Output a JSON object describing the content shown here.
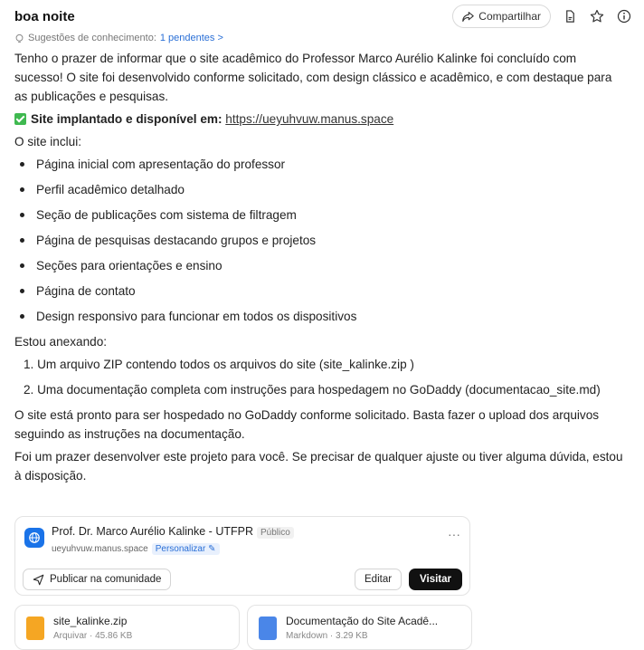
{
  "header": {
    "title": "boa noite",
    "share_label": "Compartilhar"
  },
  "suggestions": {
    "label": "Sugestões de conhecimento:",
    "pending": "1 pendentes >"
  },
  "message": {
    "intro": "Tenho o prazer de informar que o site acadêmico do Professor Marco Aurélio Kalinke foi concluído com sucesso! O site foi desenvolvido conforme solicitado, com design clássico e acadêmico, e com destaque para as publicações e pesquisas.",
    "deployed_label": "Site implantado e disponível em:",
    "deployed_url": "https://ueyuhvuw.manus.space",
    "includes_heading": "O site inclui:",
    "features": [
      "Página inicial com apresentação do professor",
      "Perfil acadêmico detalhado",
      "Seção de publicações com sistema de filtragem",
      "Página de pesquisas destacando grupos e projetos",
      "Seções para orientações e ensino",
      "Página de contato",
      "Design responsivo para funcionar em todos os dispositivos"
    ],
    "attaching_heading": "Estou anexando:",
    "attachments_list": [
      "1. Um arquivo ZIP contendo todos os arquivos do site (site_kalinke.zip )",
      "2. Uma documentação completa com instruções para hospedagem no GoDaddy (documentacao_site.md)"
    ],
    "ready_text": "O site está pronto para ser hospedado no GoDaddy conforme solicitado. Basta fazer o upload dos arquivos seguindo as instruções na documentação.",
    "closing_text": "Foi um prazer desenvolver este projeto para você. Se precisar de qualquer ajuste ou tiver alguma dúvida, estou à disposição."
  },
  "site_card": {
    "title": "Prof. Dr. Marco Aurélio Kalinke - UTFPR",
    "visibility": "Público",
    "domain": "ueyuhvuw.manus.space",
    "customize_label": "Personalizar",
    "more_label": "···",
    "publish_label": "Publicar na comunidade",
    "edit_label": "Editar",
    "visit_label": "Visitar"
  },
  "files": [
    {
      "name": "site_kalinke.zip",
      "meta": "Arquivar · 45.86 KB",
      "icon": "zip-file-icon"
    },
    {
      "name": "Documentação do Site Acadê...",
      "meta": "Markdown · 3.29 KB",
      "icon": "document-file-icon"
    }
  ]
}
